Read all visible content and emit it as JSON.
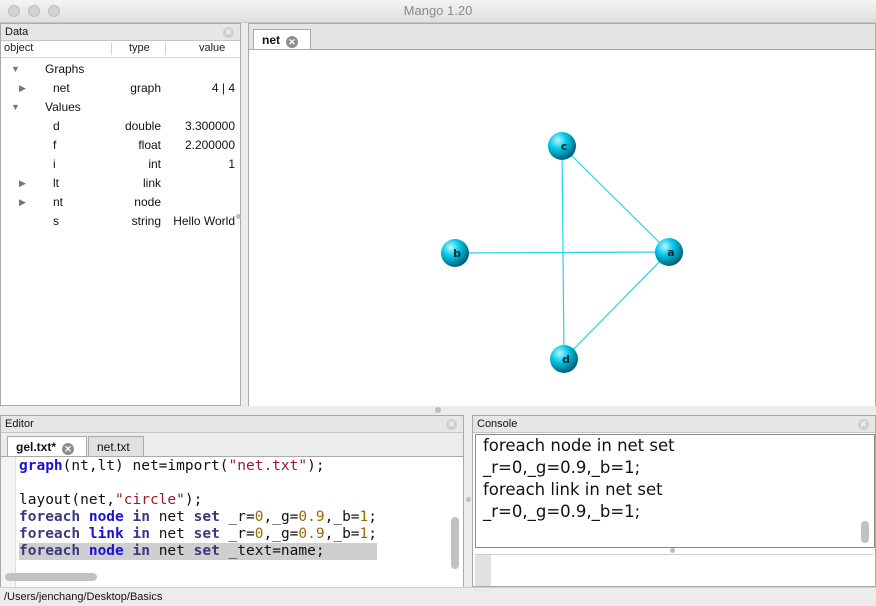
{
  "window": {
    "title": "Mango 1.20"
  },
  "data_panel": {
    "title": "Data",
    "columns": {
      "object": "object",
      "type": "type",
      "value": "value"
    },
    "rows": [
      {
        "name": "Graphs",
        "type": "",
        "value": "",
        "expander": "▼"
      },
      {
        "name": "net",
        "type": "graph",
        "value": "4 | 4",
        "expander": "▶"
      },
      {
        "name": "Values",
        "type": "",
        "value": "",
        "expander": "▼"
      },
      {
        "name": "d",
        "type": "double",
        "value": "3.300000",
        "expander": ""
      },
      {
        "name": "f",
        "type": "float",
        "value": "2.200000",
        "expander": ""
      },
      {
        "name": "i",
        "type": "int",
        "value": "1",
        "expander": ""
      },
      {
        "name": "lt",
        "type": "link",
        "value": "",
        "expander": "▶"
      },
      {
        "name": "nt",
        "type": "node",
        "value": "",
        "expander": "▶"
      },
      {
        "name": "s",
        "type": "string",
        "value": "Hello World",
        "expander": ""
      }
    ]
  },
  "graph_panel": {
    "tab_label": "net",
    "node_color": "#00c8e8",
    "edge_color": "#22d4ee",
    "nodes": [
      {
        "label": "c"
      },
      {
        "label": "b"
      },
      {
        "label": "a"
      },
      {
        "label": "d"
      }
    ]
  },
  "editor": {
    "title": "Editor",
    "tabs": [
      {
        "label": "gel.txt*"
      },
      {
        "label": "net.txt"
      }
    ],
    "lines": [
      [
        {
          "t": "graph",
          "c": "kw-blue"
        },
        {
          "t": "(nt,lt) net=import(",
          "c": ""
        },
        {
          "t": "\"net.txt\"",
          "c": "str"
        },
        {
          "t": ");",
          "c": ""
        }
      ],
      [],
      [
        {
          "t": "layout(net,",
          "c": ""
        },
        {
          "t": "\"circle\"",
          "c": "str"
        },
        {
          "t": ");",
          "c": ""
        }
      ],
      [
        {
          "t": "foreach",
          "c": "kw-dark"
        },
        {
          "t": " ",
          "c": ""
        },
        {
          "t": "node",
          "c": "kw-blue"
        },
        {
          "t": " ",
          "c": ""
        },
        {
          "t": "in",
          "c": "kw-dark"
        },
        {
          "t": " net ",
          "c": ""
        },
        {
          "t": "set",
          "c": "kw-dark"
        },
        {
          "t": " _r=",
          "c": ""
        },
        {
          "t": "0",
          "c": "num"
        },
        {
          "t": ",_g=",
          "c": ""
        },
        {
          "t": "0.9",
          "c": "num"
        },
        {
          "t": ",_b=",
          "c": ""
        },
        {
          "t": "1",
          "c": "num"
        },
        {
          "t": ";",
          "c": ""
        }
      ],
      [
        {
          "t": "foreach",
          "c": "kw-dark"
        },
        {
          "t": " ",
          "c": ""
        },
        {
          "t": "link",
          "c": "kw-blue"
        },
        {
          "t": " ",
          "c": ""
        },
        {
          "t": "in",
          "c": "kw-dark"
        },
        {
          "t": " net ",
          "c": ""
        },
        {
          "t": "set",
          "c": "kw-dark"
        },
        {
          "t": " _r=",
          "c": ""
        },
        {
          "t": "0",
          "c": "num"
        },
        {
          "t": ",_g=",
          "c": ""
        },
        {
          "t": "0.9",
          "c": "num"
        },
        {
          "t": ",_b=",
          "c": ""
        },
        {
          "t": "1",
          "c": "num"
        },
        {
          "t": ";",
          "c": ""
        }
      ],
      [
        {
          "t": "foreach",
          "c": "kw-dark"
        },
        {
          "t": " ",
          "c": ""
        },
        {
          "t": "node",
          "c": "kw-blue"
        },
        {
          "t": " ",
          "c": ""
        },
        {
          "t": "in",
          "c": "kw-dark"
        },
        {
          "t": " net ",
          "c": ""
        },
        {
          "t": "set",
          "c": "kw-dark"
        },
        {
          "t": " _text=name;",
          "c": ""
        }
      ]
    ]
  },
  "console": {
    "title": "Console",
    "lines": [
      "foreach node in net set",
      "_r=0,_g=0.9,_b=1;",
      "foreach link in net set",
      "_r=0,_g=0.9,_b=1;"
    ],
    "input_value": ""
  },
  "status_bar": {
    "path": "/Users/jenchang/Desktop/Basics"
  }
}
